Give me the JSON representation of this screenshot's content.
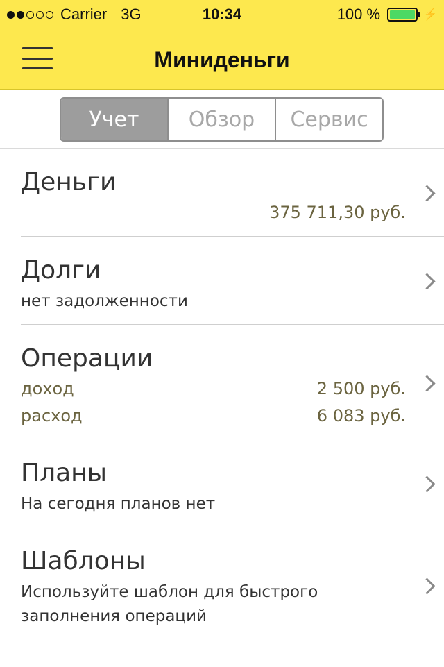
{
  "status_bar": {
    "carrier": "Carrier",
    "network": "3G",
    "time": "10:34",
    "battery": "100 %",
    "signal_icon": "signal-dots-icon",
    "battery_icon": "battery-icon",
    "charging_icon": "lightning-icon"
  },
  "nav": {
    "title": "Миниденьги",
    "menu_icon": "hamburger-menu-icon"
  },
  "tabs": [
    {
      "label": "Учет",
      "active": true
    },
    {
      "label": "Обзор",
      "active": false
    },
    {
      "label": "Сервис",
      "active": false
    }
  ],
  "list": {
    "money": {
      "title": "Деньги",
      "amount": "375 711,30 руб."
    },
    "debts": {
      "title": "Долги",
      "subtitle": "нет задолженности"
    },
    "operations": {
      "title": "Операции",
      "income_label": "доход",
      "income_amount": "2 500 руб.",
      "expense_label": "расход",
      "expense_amount": "6 083 руб."
    },
    "plans": {
      "title": "Планы",
      "subtitle": "На сегодня планов нет"
    },
    "templates": {
      "title": "Шаблоны",
      "subtitle_line1": "Используйте шаблон для быстрого",
      "subtitle_line2": "заполнения операций"
    }
  },
  "colors": {
    "header_yellow": "#fde84e",
    "amount_olive": "#6b6440",
    "segment_active": "#9d9d9d",
    "battery_green": "#4cd964"
  }
}
